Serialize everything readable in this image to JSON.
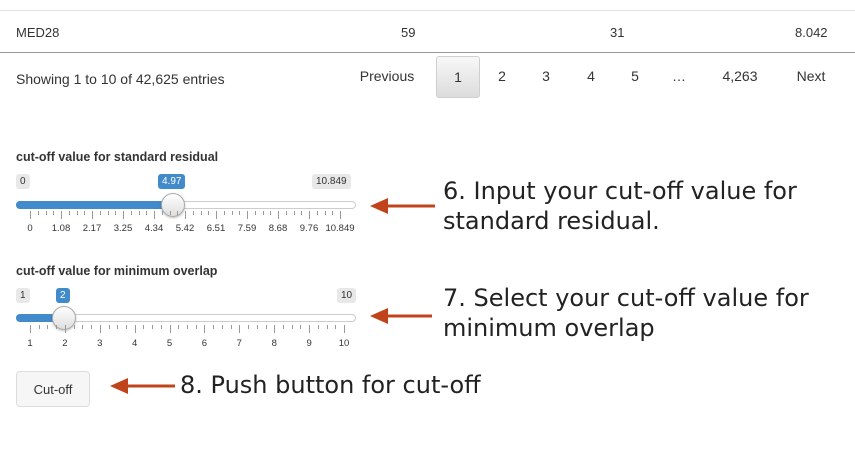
{
  "table": {
    "row": {
      "gene": "MED28",
      "col2": "59",
      "col3": "31",
      "col4": "8.042"
    },
    "info": "Showing 1 to 10 of 42,625 entries"
  },
  "pagination": {
    "previous": "Previous",
    "pages": [
      "1",
      "2",
      "3",
      "4",
      "5",
      "…",
      "4,263"
    ],
    "active": "1",
    "next": "Next"
  },
  "slider1": {
    "label": "cut-off value for standard residual",
    "min": "0",
    "max": "10.849",
    "value": "4.97",
    "ticks": [
      "0",
      "1.08",
      "2.17",
      "3.25",
      "4.34",
      "5.42",
      "6.51",
      "7.59",
      "8.68",
      "9.76",
      "10.849"
    ]
  },
  "slider2": {
    "label": "cut-off value for minimum overlap",
    "min": "1",
    "max": "10",
    "value": "2",
    "ticks": [
      "1",
      "2",
      "3",
      "4",
      "5",
      "6",
      "7",
      "8",
      "9",
      "10"
    ]
  },
  "button": {
    "label": "Cut-off"
  },
  "annotations": {
    "a6_line1": "6. Input your cut-off value for",
    "a6_line2": "standard residual.",
    "a7_line1": "7. Select your cut-off value for",
    "a7_line2": "minimum overlap",
    "a8": "8. Push button for cut-off"
  },
  "colors": {
    "accent": "#428bca",
    "arrow": "#c0441b"
  }
}
